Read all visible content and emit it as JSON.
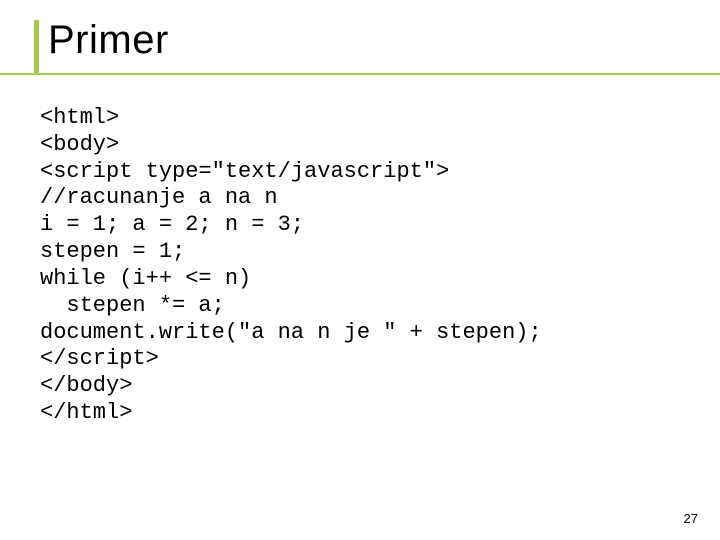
{
  "title": "Primer",
  "code_lines": [
    "<html>",
    "<body>",
    "<script type=\"text/javascript\">",
    "//racunanje a na n",
    "i = 1; a = 2; n = 3;",
    "stepen = 1;",
    "while (i++ <= n)",
    "  stepen *= a;",
    "document.write(\"a na n je \" + stepen);",
    "</script>",
    "</body>",
    "</html>"
  ],
  "page_number": "27"
}
